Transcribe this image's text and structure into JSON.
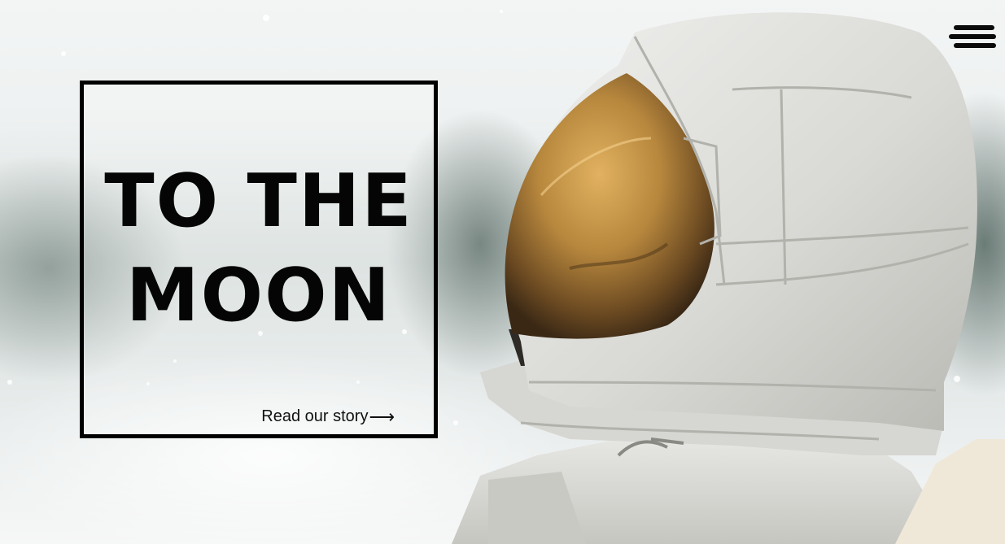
{
  "hero": {
    "title_line_1": "TO THE",
    "title_line_2": "MOON",
    "cta_label": "Read our story",
    "cta_arrow": "⟶"
  },
  "nav": {
    "menu_icon": "hamburger-menu-icon"
  },
  "colors": {
    "text": "#050505",
    "border": "#000000",
    "background": "#eef2f2",
    "visor": "#b98a3a",
    "suit": "#dcdcd8"
  },
  "image": {
    "subject_icon": "astronaut-illustration"
  }
}
